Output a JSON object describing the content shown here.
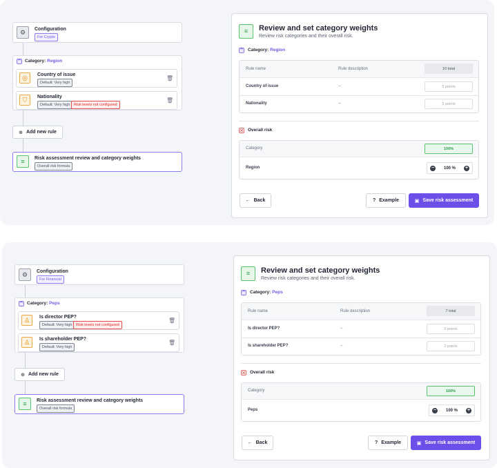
{
  "screens": [
    {
      "config": {
        "title": "Configuration",
        "badge": "For Crypto",
        "icon": "gear-icon"
      },
      "category": {
        "prefix": "Category:",
        "name": "Region"
      },
      "rules": [
        {
          "title": "Country of issue",
          "default_badge": "Default: Very high",
          "warning": "",
          "icon": "globe-icon"
        },
        {
          "title": "Nationality",
          "default_badge": "Default: Very high",
          "warning": "Risk levels not configured",
          "icon": "shield-icon"
        }
      ],
      "add_rule_label": "Add new rule",
      "review_step": {
        "title": "Risk assessment review and category weights",
        "badge": "Overall risk formula",
        "icon": "sliders-icon"
      },
      "panel": {
        "title": "Review and set category weights",
        "subtitle": "Review risk categories and their overall risk.",
        "category_prefix": "Category:",
        "category_name": "Region",
        "table_headers": {
          "name": "Rule name",
          "description": "Rule description",
          "total": "10 total"
        },
        "table_rows": [
          {
            "name": "Country of issue",
            "description": "–",
            "points": "5 points"
          },
          {
            "name": "Nationality",
            "description": "–",
            "points": "5 points"
          }
        ],
        "overall_label": "Overall risk",
        "overall_headers": {
          "category": "Category",
          "total": "100%"
        },
        "overall_rows": [
          {
            "name": "Region",
            "value": "100 %"
          }
        ],
        "back_label": "Back",
        "example_label": "Example",
        "save_label": "Save risk assessment"
      }
    },
    {
      "config": {
        "title": "Configuration",
        "badge": "For Financial",
        "icon": "gear-icon"
      },
      "category": {
        "prefix": "Category:",
        "name": "Peps"
      },
      "rules": [
        {
          "title": "Is director PEP?",
          "default_badge": "Default: Very high",
          "warning": "Risk levels not configured",
          "icon": "people-icon"
        },
        {
          "title": "Is shareholder PEP?",
          "default_badge": "Default: Very high",
          "warning": "",
          "icon": "people-icon"
        }
      ],
      "add_rule_label": "Add new rule",
      "review_step": {
        "title": "Risk assessment review and category weights",
        "badge": "Overall risk formula",
        "icon": "sliders-icon"
      },
      "panel": {
        "title": "Review and set category weights",
        "subtitle": "Review risk categories and their overall risk.",
        "category_prefix": "Category:",
        "category_name": "Peps",
        "table_headers": {
          "name": "Rule name",
          "description": "Rule description",
          "total": "7 total"
        },
        "table_rows": [
          {
            "name": "Is director PEP?",
            "description": "–",
            "points": "5 points"
          },
          {
            "name": "Is shareholder PEP?",
            "description": "–",
            "points": "2 points"
          }
        ],
        "overall_label": "Overall risk",
        "overall_headers": {
          "category": "Category",
          "total": "100%"
        },
        "overall_rows": [
          {
            "name": "Peps",
            "value": "100 %"
          }
        ],
        "back_label": "Back",
        "example_label": "Example",
        "save_label": "Save risk assessment"
      }
    }
  ],
  "icons": {
    "trash": "trash-icon",
    "plus": "plus-circle-icon",
    "arrow": "arrow-left-icon",
    "question": "question-icon",
    "save": "floppy-icon"
  },
  "colors": {
    "accent": "#6c4fe8",
    "success": "#2e9c4a",
    "warning": "#e48a12",
    "danger": "#d83030"
  }
}
